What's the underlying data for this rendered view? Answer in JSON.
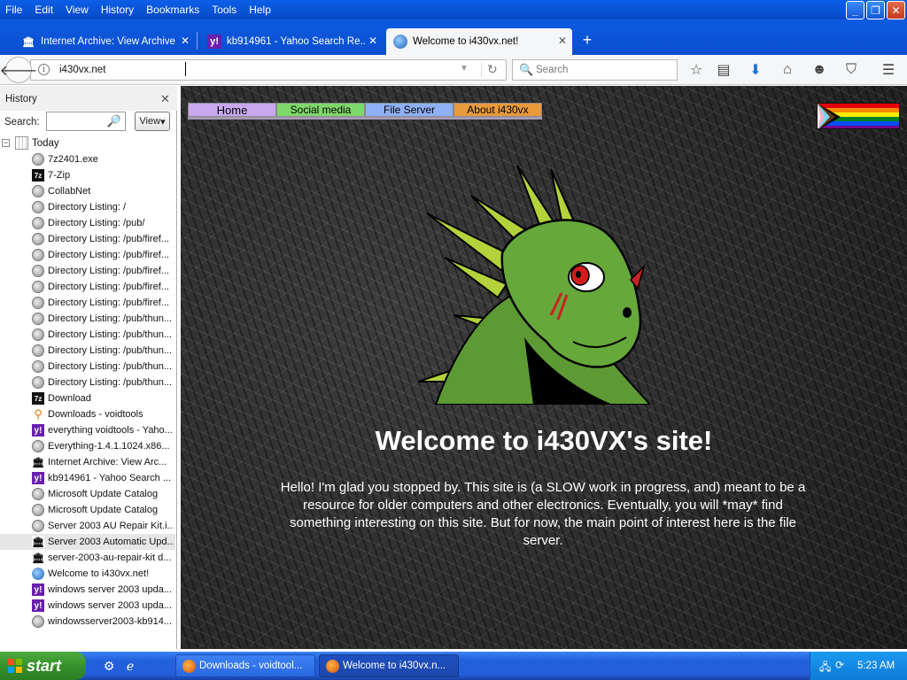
{
  "menubar": {
    "items": [
      {
        "label": "File"
      },
      {
        "label": "Edit"
      },
      {
        "label": "View"
      },
      {
        "label": "History"
      },
      {
        "label": "Bookmarks"
      },
      {
        "label": "Tools"
      },
      {
        "label": "Help"
      }
    ]
  },
  "tabs": [
    {
      "label": "Internet Archive: View Archive",
      "icon": "internet-archive-icon",
      "active": false
    },
    {
      "label": "kb914961 - Yahoo Search Re...",
      "icon": "yahoo-icon",
      "active": false
    },
    {
      "label": "Welcome to i430vx.net!",
      "icon": "site-icon",
      "active": true
    }
  ],
  "navbar": {
    "url": "i430vx.net",
    "search_placeholder": "Search"
  },
  "sidebar": {
    "title": "History",
    "search_label": "Search:",
    "search_value": "",
    "view_button": "View",
    "root_label": "Today",
    "items": [
      {
        "label": "7z2401.exe",
        "icon": "globe"
      },
      {
        "label": "7-Zip",
        "icon": "7z"
      },
      {
        "label": "CollabNet",
        "icon": "globe"
      },
      {
        "label": "Directory Listing: /",
        "icon": "globe"
      },
      {
        "label": "Directory Listing: /pub/",
        "icon": "globe"
      },
      {
        "label": "Directory Listing: /pub/firef...",
        "icon": "globe"
      },
      {
        "label": "Directory Listing: /pub/firef...",
        "icon": "globe"
      },
      {
        "label": "Directory Listing: /pub/firef...",
        "icon": "globe"
      },
      {
        "label": "Directory Listing: /pub/firef...",
        "icon": "globe"
      },
      {
        "label": "Directory Listing: /pub/firef...",
        "icon": "globe"
      },
      {
        "label": "Directory Listing: /pub/thun...",
        "icon": "globe"
      },
      {
        "label": "Directory Listing: /pub/thun...",
        "icon": "globe"
      },
      {
        "label": "Directory Listing: /pub/thun...",
        "icon": "globe"
      },
      {
        "label": "Directory Listing: /pub/thun...",
        "icon": "globe"
      },
      {
        "label": "Directory Listing: /pub/thun...",
        "icon": "globe"
      },
      {
        "label": "Download",
        "icon": "7z"
      },
      {
        "label": "Downloads - voidtools",
        "icon": "search"
      },
      {
        "label": "everything voidtools - Yaho...",
        "icon": "yahoo"
      },
      {
        "label": "Everything-1.4.1.1024.x86...",
        "icon": "globe"
      },
      {
        "label": "Internet Archive: View Arc...",
        "icon": "ia"
      },
      {
        "label": "kb914961 - Yahoo Search ...",
        "icon": "yahoo"
      },
      {
        "label": "Microsoft Update Catalog",
        "icon": "globe"
      },
      {
        "label": "Microsoft Update Catalog",
        "icon": "globe"
      },
      {
        "label": "Server 2003 AU Repair Kit.i...",
        "icon": "globe"
      },
      {
        "label": "Server 2003 Automatic Upd...",
        "icon": "ia",
        "selected": true
      },
      {
        "label": "server-2003-au-repair-kit d...",
        "icon": "ia"
      },
      {
        "label": "Welcome to i430vx.net!",
        "icon": "ff"
      },
      {
        "label": "windows server 2003 upda...",
        "icon": "yahoo"
      },
      {
        "label": "windows server 2003 upda...",
        "icon": "yahoo"
      },
      {
        "label": "windowsserver2003-kb914...",
        "icon": "globe"
      }
    ]
  },
  "page": {
    "nav": [
      {
        "label": "Home",
        "color": "#c9a8f0"
      },
      {
        "label": "Social media",
        "color": "#7fd86a"
      },
      {
        "label": "File Server",
        "color": "#8fb0f5"
      },
      {
        "label": "About i430vx",
        "color": "#e89a3c"
      }
    ],
    "welcome": "Welcome to i430VX's site!",
    "intro": "Hello! I'm glad you stopped by. This site is (a SLOW work in progress, and) meant to be a resource for older computers and other electronics. Eventually, you will *may* find something interesting on this site. But for now, the main point of interest here is the file server."
  },
  "taskbar": {
    "start_label": "start",
    "items": [
      {
        "label": "Downloads - voidtool...",
        "active": false
      },
      {
        "label": "Welcome to i430vx.n...",
        "active": true
      }
    ],
    "clock": "5:23 AM"
  }
}
